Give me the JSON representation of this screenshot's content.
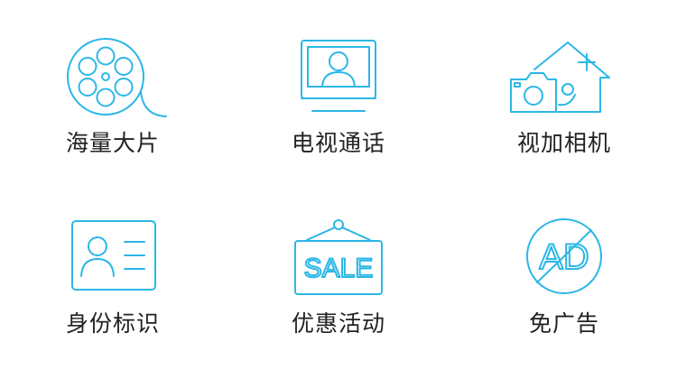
{
  "colors": {
    "icon_stroke": "#2bb7e6",
    "label_text": "#222222",
    "background": "#ffffff"
  },
  "features": [
    {
      "label": "海量大片",
      "icon": "film-reel-icon"
    },
    {
      "label": "电视通话",
      "icon": "tv-call-icon"
    },
    {
      "label": "视加相机",
      "icon": "camera-home-icon"
    },
    {
      "label": "身份标识",
      "icon": "id-card-icon"
    },
    {
      "label": "优惠活动",
      "icon": "sale-sign-icon"
    },
    {
      "label": "免广告",
      "icon": "no-ad-icon",
      "icon_text": "AD"
    }
  ],
  "sale_icon_text": "SALE"
}
